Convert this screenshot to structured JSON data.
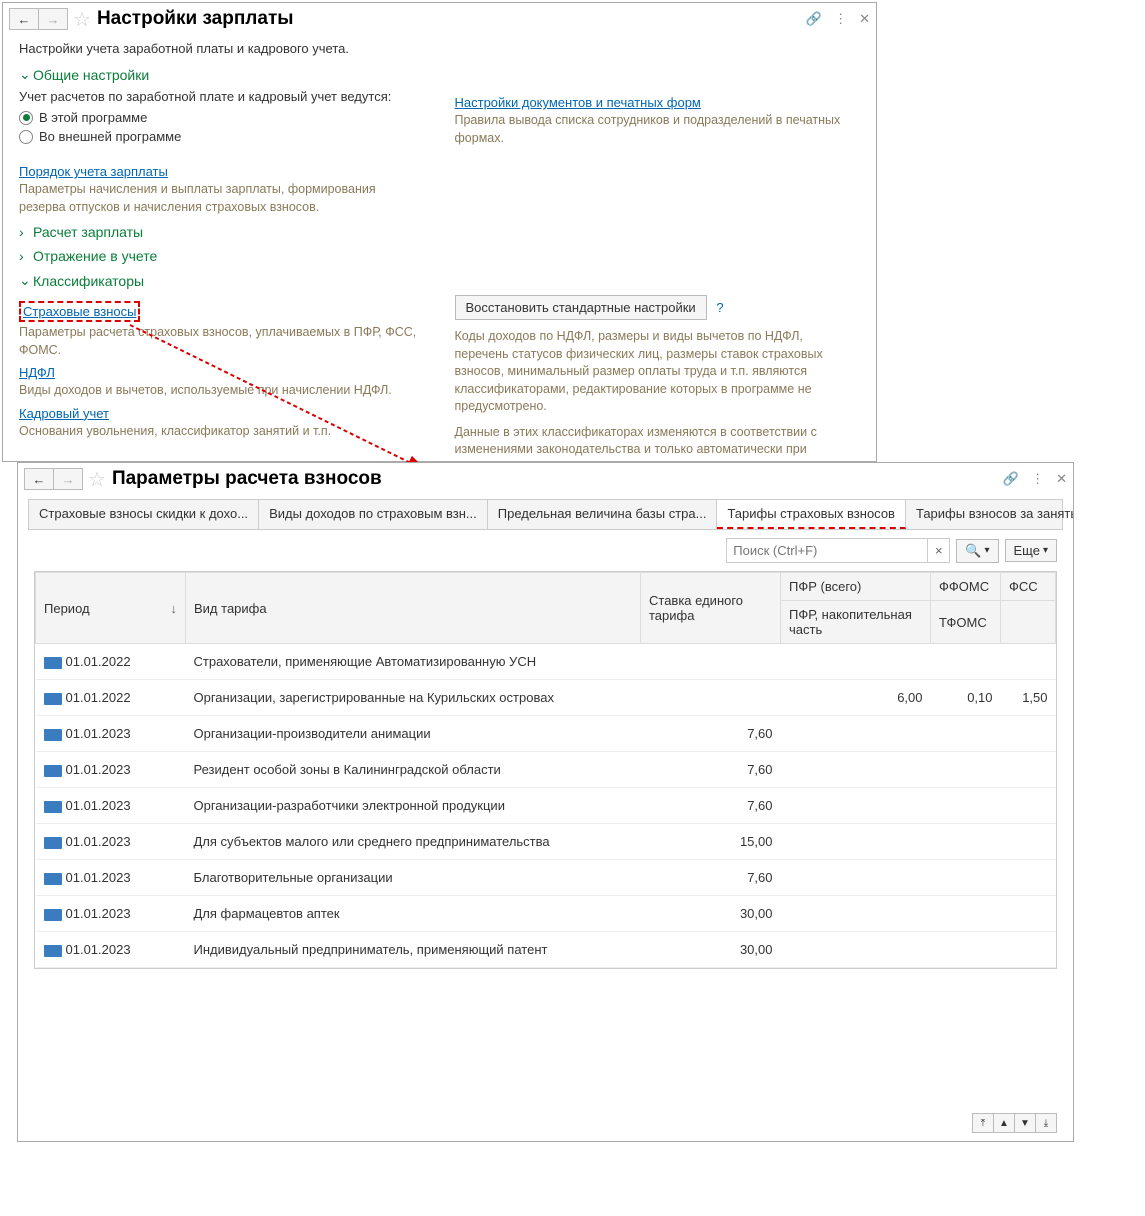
{
  "win1": {
    "title": "Настройки зарплаты",
    "subtitle": "Настройки учета заработной платы и кадрового учета.",
    "sections": {
      "general": "Общие настройки",
      "payroll_calc": "Расчет зарплаты",
      "reflection": "Отражение в учете",
      "classifiers": "Классификаторы"
    },
    "general": {
      "label": "Учет расчетов по заработной плате и кадровый учет ведутся:",
      "radio1": "В этой программе",
      "radio2": "Во внешней программе",
      "link1": "Порядок учета зарплаты",
      "help1": "Параметры начисления и выплаты зарплаты, формирования резерва отпусков и начисления страховых взносов.",
      "link2": "Настройки документов и печатных форм",
      "help2": "Правила вывода списка сотрудников и подразделений в печатных формах."
    },
    "classifiers": {
      "link1": "Страховые взносы",
      "help1": "Параметры расчета страховых взносов, уплачиваемых в ПФР, ФСС, ФОМС.",
      "link2": "НДФЛ",
      "help2": "Виды доходов и вычетов, используемые при начислении НДФЛ.",
      "link3": "Кадровый учет",
      "help3": "Основания увольнения, классификатор занятий и т.п.",
      "btn": "Восстановить стандартные настройки",
      "help_right1": "Коды доходов по НДФЛ, размеры и виды вычетов по НДФЛ, перечень статусов физических лиц, размеры ставок страховых взносов, минимальный размер оплаты труда и т.п. являются классификаторами, редактирование которых в программе не предусмотрено.",
      "help_right2": "Данные в этих классификаторах изменяются в соответствии с изменениями законодательства и только автоматически при"
    }
  },
  "win2": {
    "title": "Параметры расчета взносов",
    "tabs": [
      "Страховые взносы скидки к дохо...",
      "Виды доходов по страховым взн...",
      "Предельная величина базы стра...",
      "Тарифы страховых взносов",
      "Тарифы взносов за занятых на ра..."
    ],
    "active_tab": 3,
    "search_placeholder": "Поиск (Ctrl+F)",
    "more_btn": "Еще",
    "columns": {
      "period": "Период",
      "type": "Вид тарифа",
      "rate": "Ставка единого тарифа",
      "pfr_total": "ПФР (всего)",
      "pfr_save": "ПФР, накопительная часть",
      "ffoms": "ФФОМС",
      "tfoms": "ТФОМС",
      "fss": "ФСС"
    },
    "rows": [
      {
        "period": "01.01.2022",
        "type": "Страхователи, применяющие Автоматизированную УСН",
        "rate": "",
        "pfr": "",
        "ffoms": "",
        "fss": ""
      },
      {
        "period": "01.01.2022",
        "type": "Организации, зарегистрированные на Курильских островах",
        "rate": "",
        "pfr": "6,00",
        "ffoms": "0,10",
        "fss": "1,50"
      },
      {
        "period": "01.01.2023",
        "type": "Организации-производители анимации",
        "rate": "7,60",
        "pfr": "",
        "ffoms": "",
        "fss": ""
      },
      {
        "period": "01.01.2023",
        "type": "Резидент особой зоны в Калининградской области",
        "rate": "7,60",
        "pfr": "",
        "ffoms": "",
        "fss": ""
      },
      {
        "period": "01.01.2023",
        "type": "Организации-разработчики электронной продукции",
        "rate": "7,60",
        "pfr": "",
        "ffoms": "",
        "fss": ""
      },
      {
        "period": "01.01.2023",
        "type": "Для субъектов малого или среднего предпринимательства",
        "rate": "15,00",
        "pfr": "",
        "ffoms": "",
        "fss": ""
      },
      {
        "period": "01.01.2023",
        "type": "Благотворительные организации",
        "rate": "7,60",
        "pfr": "",
        "ffoms": "",
        "fss": ""
      },
      {
        "period": "01.01.2023",
        "type": "Для фармацевтов аптек",
        "rate": "30,00",
        "pfr": "",
        "ffoms": "",
        "fss": ""
      },
      {
        "period": "01.01.2023",
        "type": "Индивидуальный предприниматель, применяющий патент",
        "rate": "30,00",
        "pfr": "",
        "ffoms": "",
        "fss": ""
      }
    ]
  }
}
